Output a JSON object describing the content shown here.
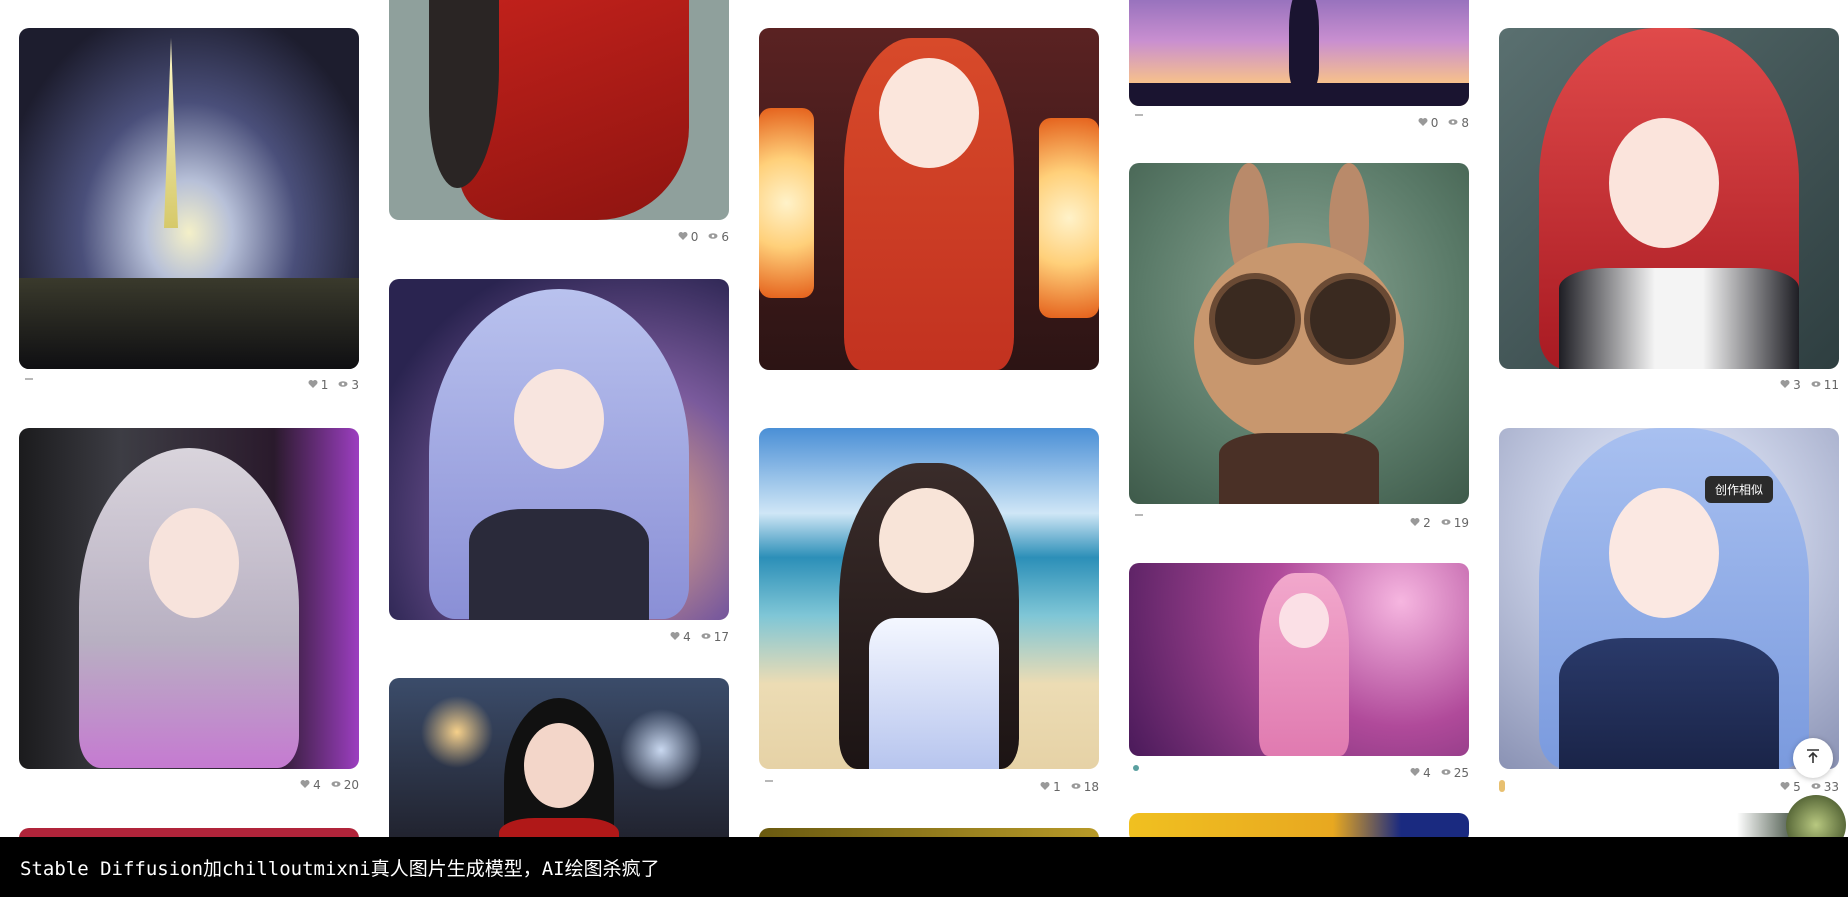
{
  "cards": [
    {
      "likes": "1",
      "views": "3"
    },
    {
      "likes": "4",
      "views": "20"
    },
    {
      "likes": "0",
      "views": "6"
    },
    {
      "likes": "4",
      "views": "17"
    },
    {
      "likes": "1",
      "views": "18"
    },
    {
      "likes": "0",
      "views": "8"
    },
    {
      "likes": "2",
      "views": "19"
    },
    {
      "likes": "4",
      "views": "25"
    },
    {
      "likes": "3",
      "views": "11"
    },
    {
      "likes": "5",
      "views": "33"
    }
  ],
  "tooltip": "创作相似",
  "caption": "Stable Diffusion加chilloutmixni真人图片生成模型，AI绘图杀疯了",
  "icons": {
    "like": "heart-icon",
    "view": "eye-icon",
    "back_to_top": "arrow-up-icon"
  }
}
